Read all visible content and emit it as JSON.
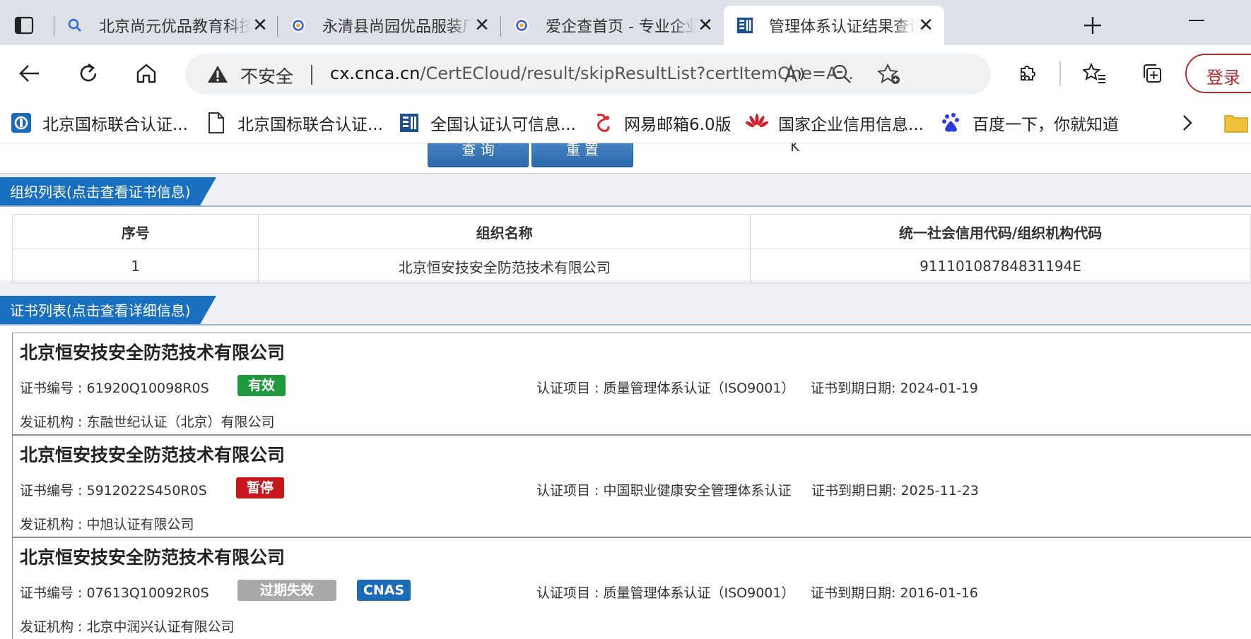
{
  "browser": {
    "tabs": [
      {
        "title": "北京尚元优品教育科技有限公司",
        "icon": "search-icon"
      },
      {
        "title": "永清县尚园优品服装厂 - 爱企查",
        "icon": "aiqicha-icon"
      },
      {
        "title": "爱企查首页 - 专业企业查询平台",
        "icon": "aiqicha-icon"
      },
      {
        "title": "管理体系认证结果查询列表",
        "icon": "cnca-icon"
      }
    ],
    "address": {
      "security_label": "不安全",
      "host": "cx.cnca.cn",
      "path": "/CertECloud/result/skipResultList?certItemOne=A..."
    },
    "login_label": "登录",
    "bookmarks": [
      {
        "label": "北京国标联合认证...",
        "icon": "bjgb-icon"
      },
      {
        "label": "北京国标联合认证...",
        "icon": "page-icon"
      },
      {
        "label": "全国认证认可信息...",
        "icon": "cnca-icon"
      },
      {
        "label": "网易邮箱6.0版",
        "icon": "netease-icon"
      },
      {
        "label": "国家企业信用信息...",
        "icon": "huawei-icon"
      },
      {
        "label": "百度一下，你就知道",
        "icon": "baidu-icon"
      }
    ]
  },
  "page": {
    "buttons": {
      "query": "查 询",
      "reset": "重 置"
    },
    "org_section": {
      "title": "组织列表(点击查看证书信息)",
      "columns": [
        "序号",
        "组织名称",
        "统一社会信用代码/组织机构代码"
      ],
      "rows": [
        [
          "1",
          "北京恒安技安全防范技术有限公司",
          "91110108784831194E"
        ]
      ]
    },
    "cert_section": {
      "title": "证书列表(点击查看详细信息)",
      "labels": {
        "cert_no": "证书编号 : ",
        "issuer": "发证机构 : ",
        "item": "认证项目 : ",
        "expiry": "证书到期日期: "
      },
      "certs": [
        {
          "org": "北京恒安技安全防范技术有限公司",
          "cert_no": "61920Q10098R0S",
          "status": "有效",
          "status_color": "#1e9a3c",
          "item": "质量管理体系认证（ISO9001）",
          "expiry": "2024-01-19",
          "issuer": "东融世纪认证（北京）有限公司"
        },
        {
          "org": "北京恒安技安全防范技术有限公司",
          "cert_no": "5912022S450R0S",
          "status": "暂停",
          "status_color": "#c8161d",
          "item": "中国职业健康安全管理体系认证",
          "expiry": "2025-11-23",
          "issuer": "中旭认证有限公司"
        },
        {
          "org": "北京恒安技安全防范技术有限公司",
          "cert_no": "07613Q10092R0S",
          "status": "过期失效",
          "status_color": "#a9a9a9",
          "extra_badge": "CNAS",
          "extra_badge_color": "#1a6bb8",
          "item": "质量管理体系认证（ISO9001）",
          "expiry": "2016-01-16",
          "issuer": "北京中润兴认证有限公司"
        }
      ]
    }
  }
}
